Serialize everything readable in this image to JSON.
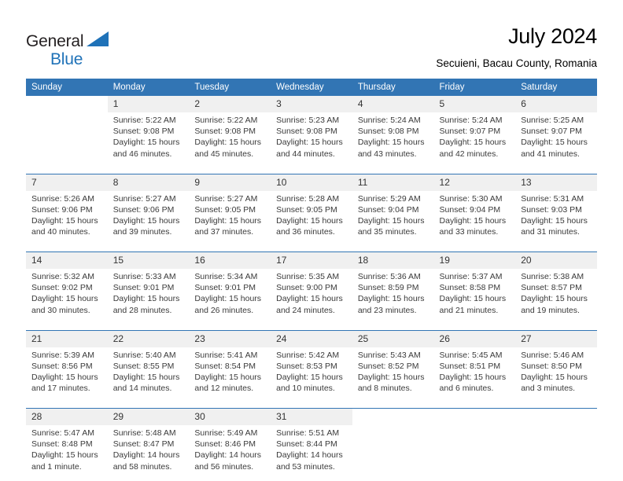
{
  "brand": {
    "name_part1": "General",
    "name_part2": "Blue",
    "accent_color": "#1f72b8",
    "triangle_icon": "triangle-icon"
  },
  "header": {
    "title": "July 2024",
    "subtitle": "Secuieni, Bacau County, Romania",
    "header_bg_color": "#3275b4"
  },
  "calendar": {
    "weekday_headers": [
      "Sunday",
      "Monday",
      "Tuesday",
      "Wednesday",
      "Thursday",
      "Friday",
      "Saturday"
    ],
    "weeks": [
      [
        {
          "day": "",
          "sunrise": "",
          "sunset": "",
          "daylight_line1": "",
          "daylight_line2": ""
        },
        {
          "day": "1",
          "sunrise": "Sunrise: 5:22 AM",
          "sunset": "Sunset: 9:08 PM",
          "daylight_line1": "Daylight: 15 hours",
          "daylight_line2": "and 46 minutes."
        },
        {
          "day": "2",
          "sunrise": "Sunrise: 5:22 AM",
          "sunset": "Sunset: 9:08 PM",
          "daylight_line1": "Daylight: 15 hours",
          "daylight_line2": "and 45 minutes."
        },
        {
          "day": "3",
          "sunrise": "Sunrise: 5:23 AM",
          "sunset": "Sunset: 9:08 PM",
          "daylight_line1": "Daylight: 15 hours",
          "daylight_line2": "and 44 minutes."
        },
        {
          "day": "4",
          "sunrise": "Sunrise: 5:24 AM",
          "sunset": "Sunset: 9:08 PM",
          "daylight_line1": "Daylight: 15 hours",
          "daylight_line2": "and 43 minutes."
        },
        {
          "day": "5",
          "sunrise": "Sunrise: 5:24 AM",
          "sunset": "Sunset: 9:07 PM",
          "daylight_line1": "Daylight: 15 hours",
          "daylight_line2": "and 42 minutes."
        },
        {
          "day": "6",
          "sunrise": "Sunrise: 5:25 AM",
          "sunset": "Sunset: 9:07 PM",
          "daylight_line1": "Daylight: 15 hours",
          "daylight_line2": "and 41 minutes."
        }
      ],
      [
        {
          "day": "7",
          "sunrise": "Sunrise: 5:26 AM",
          "sunset": "Sunset: 9:06 PM",
          "daylight_line1": "Daylight: 15 hours",
          "daylight_line2": "and 40 minutes."
        },
        {
          "day": "8",
          "sunrise": "Sunrise: 5:27 AM",
          "sunset": "Sunset: 9:06 PM",
          "daylight_line1": "Daylight: 15 hours",
          "daylight_line2": "and 39 minutes."
        },
        {
          "day": "9",
          "sunrise": "Sunrise: 5:27 AM",
          "sunset": "Sunset: 9:05 PM",
          "daylight_line1": "Daylight: 15 hours",
          "daylight_line2": "and 37 minutes."
        },
        {
          "day": "10",
          "sunrise": "Sunrise: 5:28 AM",
          "sunset": "Sunset: 9:05 PM",
          "daylight_line1": "Daylight: 15 hours",
          "daylight_line2": "and 36 minutes."
        },
        {
          "day": "11",
          "sunrise": "Sunrise: 5:29 AM",
          "sunset": "Sunset: 9:04 PM",
          "daylight_line1": "Daylight: 15 hours",
          "daylight_line2": "and 35 minutes."
        },
        {
          "day": "12",
          "sunrise": "Sunrise: 5:30 AM",
          "sunset": "Sunset: 9:04 PM",
          "daylight_line1": "Daylight: 15 hours",
          "daylight_line2": "and 33 minutes."
        },
        {
          "day": "13",
          "sunrise": "Sunrise: 5:31 AM",
          "sunset": "Sunset: 9:03 PM",
          "daylight_line1": "Daylight: 15 hours",
          "daylight_line2": "and 31 minutes."
        }
      ],
      [
        {
          "day": "14",
          "sunrise": "Sunrise: 5:32 AM",
          "sunset": "Sunset: 9:02 PM",
          "daylight_line1": "Daylight: 15 hours",
          "daylight_line2": "and 30 minutes."
        },
        {
          "day": "15",
          "sunrise": "Sunrise: 5:33 AM",
          "sunset": "Sunset: 9:01 PM",
          "daylight_line1": "Daylight: 15 hours",
          "daylight_line2": "and 28 minutes."
        },
        {
          "day": "16",
          "sunrise": "Sunrise: 5:34 AM",
          "sunset": "Sunset: 9:01 PM",
          "daylight_line1": "Daylight: 15 hours",
          "daylight_line2": "and 26 minutes."
        },
        {
          "day": "17",
          "sunrise": "Sunrise: 5:35 AM",
          "sunset": "Sunset: 9:00 PM",
          "daylight_line1": "Daylight: 15 hours",
          "daylight_line2": "and 24 minutes."
        },
        {
          "day": "18",
          "sunrise": "Sunrise: 5:36 AM",
          "sunset": "Sunset: 8:59 PM",
          "daylight_line1": "Daylight: 15 hours",
          "daylight_line2": "and 23 minutes."
        },
        {
          "day": "19",
          "sunrise": "Sunrise: 5:37 AM",
          "sunset": "Sunset: 8:58 PM",
          "daylight_line1": "Daylight: 15 hours",
          "daylight_line2": "and 21 minutes."
        },
        {
          "day": "20",
          "sunrise": "Sunrise: 5:38 AM",
          "sunset": "Sunset: 8:57 PM",
          "daylight_line1": "Daylight: 15 hours",
          "daylight_line2": "and 19 minutes."
        }
      ],
      [
        {
          "day": "21",
          "sunrise": "Sunrise: 5:39 AM",
          "sunset": "Sunset: 8:56 PM",
          "daylight_line1": "Daylight: 15 hours",
          "daylight_line2": "and 17 minutes."
        },
        {
          "day": "22",
          "sunrise": "Sunrise: 5:40 AM",
          "sunset": "Sunset: 8:55 PM",
          "daylight_line1": "Daylight: 15 hours",
          "daylight_line2": "and 14 minutes."
        },
        {
          "day": "23",
          "sunrise": "Sunrise: 5:41 AM",
          "sunset": "Sunset: 8:54 PM",
          "daylight_line1": "Daylight: 15 hours",
          "daylight_line2": "and 12 minutes."
        },
        {
          "day": "24",
          "sunrise": "Sunrise: 5:42 AM",
          "sunset": "Sunset: 8:53 PM",
          "daylight_line1": "Daylight: 15 hours",
          "daylight_line2": "and 10 minutes."
        },
        {
          "day": "25",
          "sunrise": "Sunrise: 5:43 AM",
          "sunset": "Sunset: 8:52 PM",
          "daylight_line1": "Daylight: 15 hours",
          "daylight_line2": "and 8 minutes."
        },
        {
          "day": "26",
          "sunrise": "Sunrise: 5:45 AM",
          "sunset": "Sunset: 8:51 PM",
          "daylight_line1": "Daylight: 15 hours",
          "daylight_line2": "and 6 minutes."
        },
        {
          "day": "27",
          "sunrise": "Sunrise: 5:46 AM",
          "sunset": "Sunset: 8:50 PM",
          "daylight_line1": "Daylight: 15 hours",
          "daylight_line2": "and 3 minutes."
        }
      ],
      [
        {
          "day": "28",
          "sunrise": "Sunrise: 5:47 AM",
          "sunset": "Sunset: 8:48 PM",
          "daylight_line1": "Daylight: 15 hours",
          "daylight_line2": "and 1 minute."
        },
        {
          "day": "29",
          "sunrise": "Sunrise: 5:48 AM",
          "sunset": "Sunset: 8:47 PM",
          "daylight_line1": "Daylight: 14 hours",
          "daylight_line2": "and 58 minutes."
        },
        {
          "day": "30",
          "sunrise": "Sunrise: 5:49 AM",
          "sunset": "Sunset: 8:46 PM",
          "daylight_line1": "Daylight: 14 hours",
          "daylight_line2": "and 56 minutes."
        },
        {
          "day": "31",
          "sunrise": "Sunrise: 5:51 AM",
          "sunset": "Sunset: 8:44 PM",
          "daylight_line1": "Daylight: 14 hours",
          "daylight_line2": "and 53 minutes."
        },
        {
          "day": "",
          "sunrise": "",
          "sunset": "",
          "daylight_line1": "",
          "daylight_line2": ""
        },
        {
          "day": "",
          "sunrise": "",
          "sunset": "",
          "daylight_line1": "",
          "daylight_line2": ""
        },
        {
          "day": "",
          "sunrise": "",
          "sunset": "",
          "daylight_line1": "",
          "daylight_line2": ""
        }
      ]
    ]
  }
}
